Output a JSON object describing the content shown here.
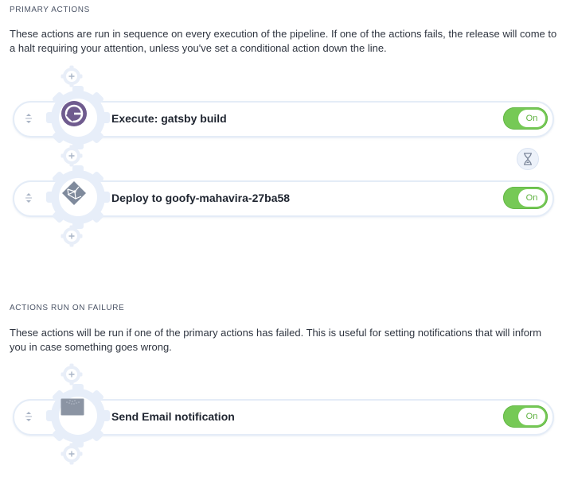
{
  "sections": {
    "primary": {
      "title": "PRIMARY ACTIONS",
      "description": "These actions are run in sequence on every execution of the pipeline. If one of the actions fails, the release will come to a halt requiring your attention, unless you've set a conditional action down the line."
    },
    "failure": {
      "title": "ACTIONS RUN ON FAILURE",
      "description": "These actions will be run if one of the primary actions has failed. This is useful for setting notifications that will inform you in case something goes wrong."
    }
  },
  "actions": {
    "gatsby": {
      "label": "Execute: gatsby build",
      "toggle": "On",
      "icon": "gatsby-logo-icon"
    },
    "deploy": {
      "label": "Deploy to goofy-mahavira-27ba58",
      "toggle": "On",
      "icon": "netlify-logo-icon"
    },
    "email": {
      "label": "Send Email notification",
      "toggle": "On",
      "icon": "envelope-icon"
    }
  },
  "colors": {
    "toggle_on": "#76c956",
    "gear": "#e7eef9",
    "gatsby": "#6f5b8e"
  }
}
